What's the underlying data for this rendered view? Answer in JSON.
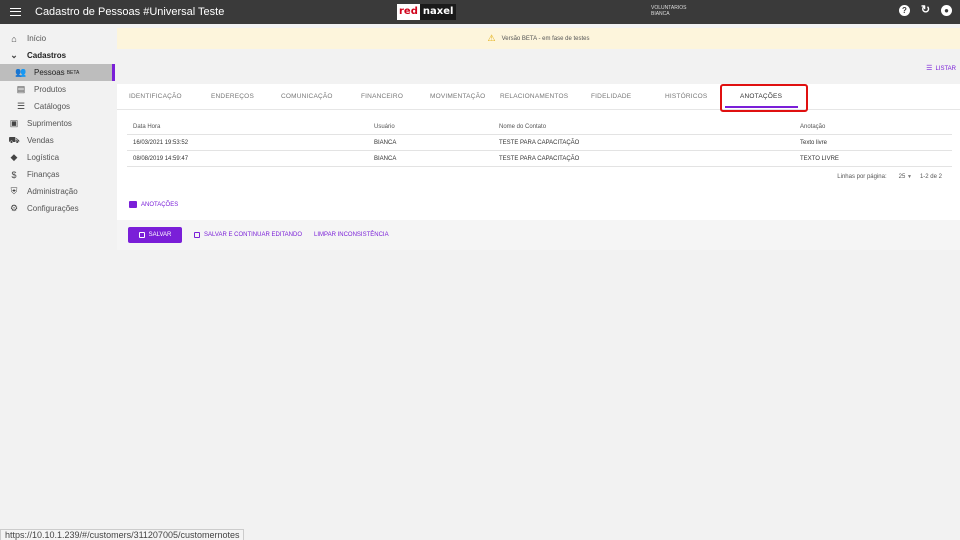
{
  "header": {
    "title": "Cadastro de Pessoas #Universal Teste",
    "logo_left": "red",
    "logo_right": "naxel",
    "user_org": "VOLUNTARIOS",
    "user_name": "BIANCA",
    "icons": [
      "menu-icon",
      "help-icon",
      "refresh-icon",
      "account-icon"
    ]
  },
  "sidebar": {
    "items": [
      {
        "label": "Início",
        "icon": "home-icon"
      },
      {
        "label": "Cadastros",
        "icon": "chevron-down-icon"
      },
      {
        "label": "Pessoas",
        "badge": "BETA",
        "icon": "people-icon"
      },
      {
        "label": "Produtos",
        "icon": "book-icon"
      },
      {
        "label": "Catálogos",
        "icon": "list-icon"
      },
      {
        "label": "Suprimentos",
        "icon": "briefcase-icon"
      },
      {
        "label": "Vendas",
        "icon": "cart-icon"
      },
      {
        "label": "Logística",
        "icon": "diamond-icon"
      },
      {
        "label": "Finanças",
        "icon": "dollar-icon"
      },
      {
        "label": "Administração",
        "icon": "shield-icon"
      },
      {
        "label": "Configurações",
        "icon": "gear-icon"
      }
    ]
  },
  "banner": {
    "text": "Versão BETA - em fase de testes"
  },
  "listar_label": "LISTAR",
  "tabs": [
    "IDENTIFICAÇÃO",
    "ENDEREÇOS",
    "COMUNICAÇÃO",
    "FINANCEIRO",
    "MOVIMENTAÇÃO",
    "RELACIONAMENTOS",
    "FIDELIDADE",
    "HISTÓRICOS",
    "ANOTAÇÕES"
  ],
  "table": {
    "headers": [
      "Data Hora",
      "Usuário",
      "Nome do Contato",
      "Anotação"
    ],
    "rows": [
      [
        "16/03/2021 19:53:52",
        "BIANCA",
        "TESTE PARA CAPACITAÇÃO",
        "Texto livre"
      ],
      [
        "08/08/2019 14:59:47",
        "BIANCA",
        "TESTE PARA CAPACITAÇÃO",
        "TEXTO LIVRE"
      ]
    ]
  },
  "pager": {
    "label": "Linhas por página:",
    "per_page": "25",
    "range": "1-2 de 2"
  },
  "anotacoes_link": "ANOTAÇÕES",
  "actions": {
    "save": "SALVAR",
    "save_continue": "SALVAR E CONTINUAR EDITANDO",
    "clear": "LIMPAR INCONSISTÊNCIA"
  },
  "status_url": "https://10.10.1.239/#/customers/311207005/customernotes",
  "colors": {
    "accent": "#7a1fd8",
    "topbar": "#3a3a3a",
    "highlight": "#e01010"
  }
}
